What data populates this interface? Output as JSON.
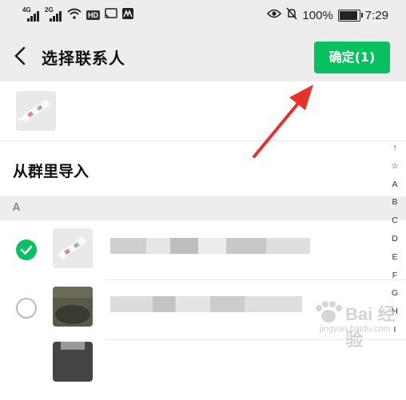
{
  "status_bar": {
    "signal1_label": "4G",
    "signal2_label": "2G",
    "hd_label": "HD",
    "battery": "100%",
    "time": "7:29"
  },
  "header": {
    "title": "选择联系人",
    "confirm_label": "确定(1)"
  },
  "from_group_label": "从群里导入",
  "section_letter": "A",
  "index_letters": [
    "↑",
    "☆",
    "A",
    "B",
    "C",
    "D",
    "E",
    "F",
    "G",
    "H",
    "I"
  ],
  "contacts": [
    {
      "checked": true
    },
    {
      "checked": false
    },
    {
      "checked": false
    }
  ],
  "watermark": {
    "text": "Bai 经验",
    "sub": "jingyan.baidu.com"
  },
  "colors": {
    "accent": "#07c160",
    "header_bg": "#ededed",
    "arrow": "#e8312a"
  },
  "icons": [
    "back-arrow-icon",
    "eye-icon",
    "bell-off-icon",
    "wifi-icon",
    "cast-icon",
    "check-icon"
  ]
}
